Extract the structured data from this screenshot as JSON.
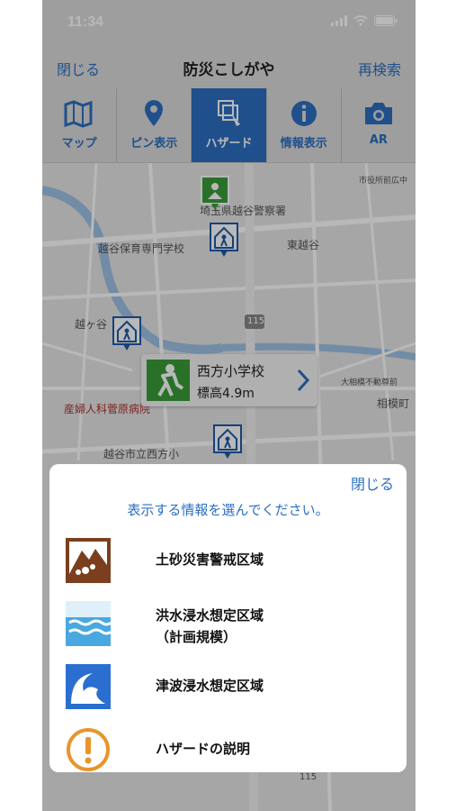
{
  "status": {
    "time": "11:34"
  },
  "nav": {
    "left": "閉じる",
    "title": "防災こしがや",
    "right": "再検索"
  },
  "toolbar": [
    {
      "label": "マップ",
      "icon": "map-icon"
    },
    {
      "label": "ピン表示",
      "icon": "pin-icon"
    },
    {
      "label": "ハザード",
      "icon": "hazard-icon",
      "active": true
    },
    {
      "label": "情報表示",
      "icon": "info-icon"
    },
    {
      "label": "AR",
      "icon": "camera-icon"
    }
  ],
  "map": {
    "labels": {
      "police": "埼玉県越谷警察署",
      "hoiku": "越谷保育専門学校",
      "higashi": "東越谷",
      "koshigaya": "越ヶ谷",
      "city": "市役所前広中",
      "road": "115",
      "hospital": "産婦人科菅原病院",
      "school_near": "越谷市立西方小",
      "sagami": "相模町",
      "oosagami": "大相模不動尊前",
      "road2": "115"
    },
    "callout": {
      "name": "西方小学校",
      "elevation": "標高4.9m"
    }
  },
  "sheet": {
    "close": "閉じる",
    "prompt": "表示する情報を選んでください。",
    "items": [
      {
        "label": "土砂災害警戒区域",
        "icon": "landslide-icon",
        "color": "#7b3f1e"
      },
      {
        "label": "洪水浸水想定区域",
        "label2": "（計画規模）",
        "icon": "flood-icon",
        "color": "#4aa8e0"
      },
      {
        "label": "津波浸水想定区域",
        "icon": "tsunami-icon",
        "color": "#2a6fd0"
      },
      {
        "label": "ハザードの説明",
        "icon": "warning-icon",
        "color": "#e8952a"
      }
    ]
  },
  "colors": {
    "accent": "#2c6fc1",
    "shelter_green": "#3a9d3a"
  }
}
